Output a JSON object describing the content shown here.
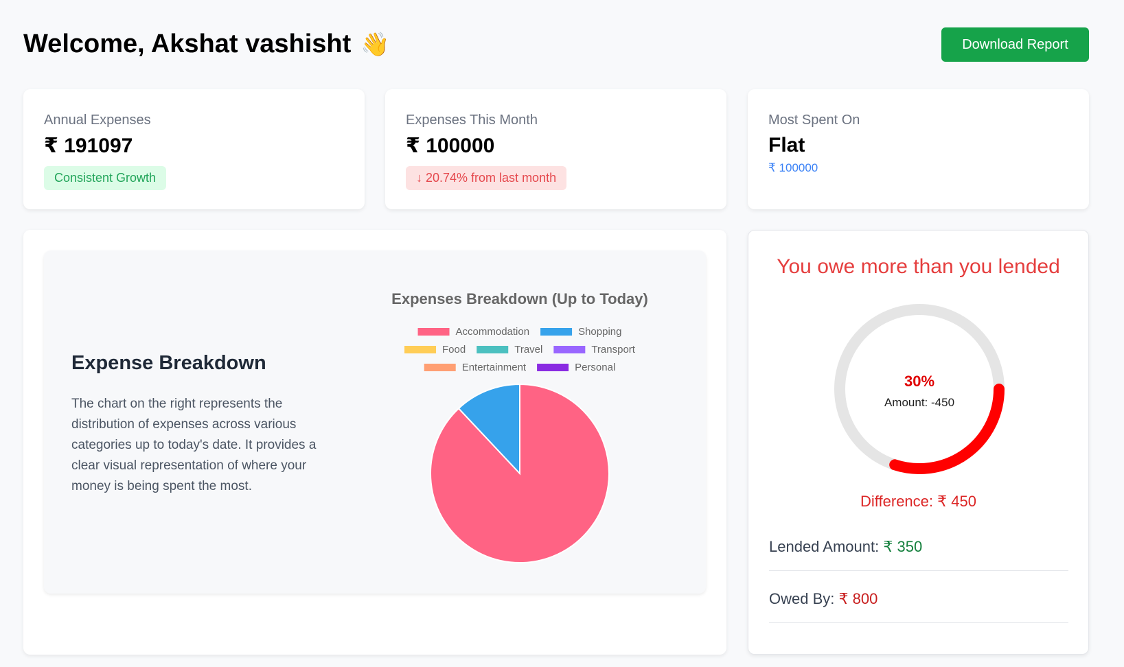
{
  "header": {
    "welcome": "Welcome, Akshat vashisht",
    "wave_icon": "👋",
    "download_label": "Download Report"
  },
  "stats": {
    "annual": {
      "label": "Annual Expenses",
      "value": "₹ 191097",
      "badge": "Consistent Growth"
    },
    "month": {
      "label": "Expenses This Month",
      "value": "₹ 100000",
      "badge": "↓ 20.74% from last month"
    },
    "most": {
      "label": "Most Spent On",
      "value": "Flat",
      "amount": "₹ 100000"
    }
  },
  "breakdown": {
    "title": "Expense Breakdown",
    "description": "The chart on the right represents the distribution of expenses across various categories up to today's date. It provides a clear visual representation of where your money is being spent the most."
  },
  "chart_data": {
    "type": "pie",
    "title": "Expenses Breakdown (Up to Today)",
    "categories": [
      "Accommodation",
      "Shopping",
      "Food",
      "Travel",
      "Transport",
      "Entertainment",
      "Personal"
    ],
    "values": [
      88,
      12,
      0,
      0,
      0,
      0,
      0
    ],
    "colors": [
      "#ff6384",
      "#36a2eb",
      "#ffcd56",
      "#4bc0c0",
      "#9966ff",
      "#ff9f73",
      "#8a2be2"
    ],
    "legend_position": "top",
    "legend_rows": [
      [
        "Accommodation",
        "Shopping"
      ],
      [
        "Food",
        "Travel",
        "Transport"
      ],
      [
        "Entertainment",
        "Personal"
      ]
    ]
  },
  "owe": {
    "title": "You owe more than you lended",
    "percent": "30%",
    "percent_value": 30,
    "amount_label": "Amount: -450",
    "difference": "Difference: ₹ 450",
    "lended_label": "Lended Amount:",
    "lended_value": "₹ 350",
    "owed_label": "Owed By:",
    "owed_value": "₹ 800",
    "progress_color": "#ff0000",
    "track_color": "#e5e5e5"
  }
}
